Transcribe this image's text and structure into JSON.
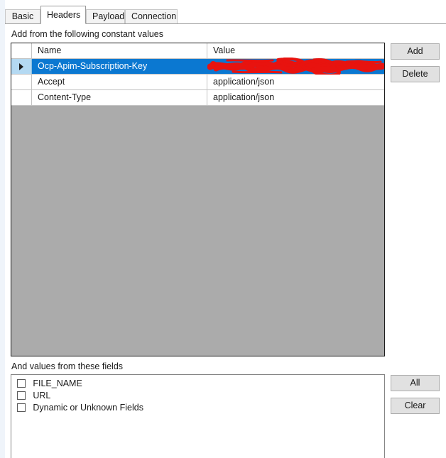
{
  "tabs": [
    {
      "id": "basic",
      "label": "Basic",
      "selected": false
    },
    {
      "id": "headers",
      "label": "Headers",
      "selected": true
    },
    {
      "id": "payload",
      "label": "Payload",
      "selected": false
    },
    {
      "id": "connection",
      "label": "Connection",
      "selected": false
    }
  ],
  "constants_section": {
    "label": "Add from the following constant values",
    "grid": {
      "columns": [
        "",
        "Name",
        "Value"
      ],
      "rows": [
        {
          "selected": true,
          "indicator": "row-selector-arrow",
          "name": "Ocp-Apim-Subscription-Key",
          "value": "",
          "value_redacted": true
        },
        {
          "selected": false,
          "indicator": "",
          "name": "Accept",
          "value": "application/json",
          "value_redacted": false
        },
        {
          "selected": false,
          "indicator": "",
          "name": "Content-Type",
          "value": "application/json",
          "value_redacted": false
        }
      ]
    },
    "buttons": {
      "add": "Add",
      "delete": "Delete"
    }
  },
  "fields_section": {
    "label": "And values from these fields",
    "items": [
      {
        "label": "FILE_NAME",
        "checked": false
      },
      {
        "label": "URL",
        "checked": false
      },
      {
        "label": "Dynamic or Unknown Fields",
        "checked": false
      }
    ],
    "buttons": {
      "all": "All",
      "clear": "Clear"
    }
  },
  "colors": {
    "selection_blue": "#0b78d1",
    "gutter_selected": "#b4d9f2",
    "grid_empty_gray": "#ababab",
    "redaction_red": "#e8130f",
    "button_face": "#e1e1e1",
    "tab_inactive": "#f3f3f3"
  }
}
